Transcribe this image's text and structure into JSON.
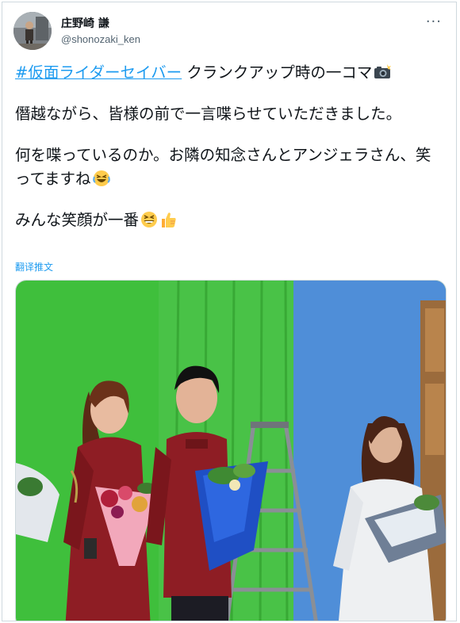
{
  "tweet": {
    "author": {
      "display_name": "庄野崎 謙",
      "handle": "@shonozaki_ken",
      "avatar_icon": "profile-avatar"
    },
    "more_icon": "more-horizontal-icon",
    "text": {
      "hashtag": "#仮面ライダーセイバー",
      "line1_rest": " クランクアップ時の一コマ",
      "line1_emoji": "camera-flash-emoji",
      "para2": "僭越ながら、皆様の前で一言喋らせていただきました。",
      "para3": "何を喋っているのか。お隣の知念さんとアンジェラさん、笑ってますね",
      "para3_emoji": "rolling-laughing-emoji",
      "para4": "みんな笑顔が一番",
      "para4_emojis": [
        "grinning-squinting-emoji",
        "thumbs-up-emoji"
      ]
    },
    "translate_label": "翻译推文",
    "photo": {
      "subject": "three cast members holding bouquets in front of a green screen"
    }
  },
  "colors": {
    "link": "#1d9bf0",
    "text": "#0f1419",
    "secondary": "#536471",
    "border": "#cfd9de"
  }
}
